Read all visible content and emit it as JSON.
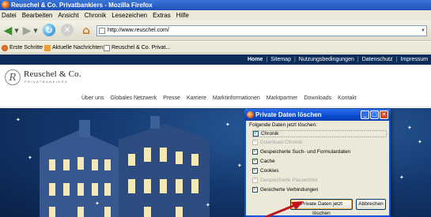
{
  "window": {
    "title": "Reuschel & Co. Privatbankiers - Mozilla Firefox"
  },
  "menu": [
    "Datei",
    "Bearbeiten",
    "Ansicht",
    "Chronik",
    "Lesezeichen",
    "Extras",
    "Hilfe"
  ],
  "toolbar": {
    "url": "http://www.reuschel.com/"
  },
  "bookmarks": [
    "Erste Schritte",
    "Aktuelle Nachrichten",
    "Reuschel & Co. Privat..."
  ],
  "site": {
    "topnav": [
      "Home",
      "Sitemap",
      "Nutzungsbedingungen",
      "Datenschutz",
      "Impressum"
    ],
    "topnav_sep": "|",
    "logo_initial": "R",
    "logo_name": "Reuschel & Co.",
    "logo_sub": "PRIVATBANKIERS",
    "mainnav": [
      "Über uns",
      "Globales Netzwerk",
      "Presse",
      "Karriere",
      "Marktinformationen",
      "Marktpartner",
      "Downloads",
      "Kontakt"
    ]
  },
  "dialog": {
    "title": "Private Daten löschen",
    "prompt": "Folgende Daten jetzt löschen:",
    "items": [
      {
        "label": "Chronik",
        "checked": true,
        "disabled": false
      },
      {
        "label": "Download-Chronik",
        "checked": true,
        "disabled": true
      },
      {
        "label": "Gespeicherte Such- und Formulardaten",
        "checked": true,
        "disabled": false
      },
      {
        "label": "Cache",
        "checked": true,
        "disabled": false
      },
      {
        "label": "Cookies",
        "checked": true,
        "disabled": false
      },
      {
        "label": "Gespeicherte Passwörter",
        "checked": true,
        "disabled": true
      },
      {
        "label": "Gesicherte Verbindungen",
        "checked": true,
        "disabled": false
      }
    ],
    "clear_button": "Private Daten jetzt löschen",
    "cancel_button": "Abbrechen"
  },
  "colors": {
    "titlebar": "#1f4fb5",
    "site_nav": "#0d2c58",
    "arrow": "#c0141c"
  }
}
